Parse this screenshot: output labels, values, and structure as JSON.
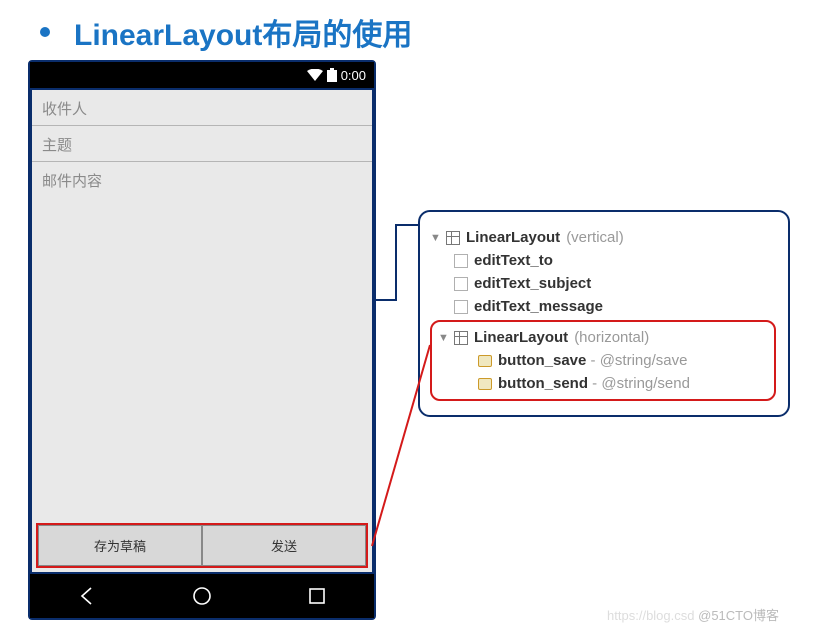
{
  "heading": {
    "title": "LinearLayout布局的使用"
  },
  "statusbar": {
    "time": "0:00"
  },
  "fields": {
    "to_placeholder": "收件人",
    "subject_placeholder": "主题",
    "message_placeholder": "邮件内容"
  },
  "buttons": {
    "save_label": "存为草稿",
    "send_label": "发送"
  },
  "tree": {
    "root_name": "LinearLayout",
    "root_qual": "(vertical)",
    "items": {
      "et_to": "editText_to",
      "et_subject": "editText_subject",
      "et_message": "editText_message"
    },
    "inner_name": "LinearLayout",
    "inner_qual": "(horizontal)",
    "btn_save_name": "button_save",
    "btn_save_attr": "@string/save",
    "btn_send_name": "button_send",
    "btn_send_attr": "@string/send",
    "separator": " - "
  },
  "watermark": {
    "faint": "https://blog.csd",
    "text": "@51CTO博客"
  }
}
